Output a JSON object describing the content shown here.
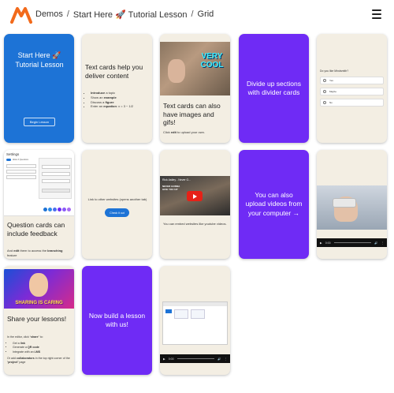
{
  "app": {
    "brand_color": "#f26a1b"
  },
  "breadcrumb": {
    "items": [
      "Demos",
      "Start Here 🚀 Tutorial Lesson",
      "Grid"
    ],
    "separator": "/"
  },
  "menu": {
    "icon": "hamburger-icon"
  },
  "colors": {
    "blue": "#1d73d6",
    "purple": "#6f2bf5",
    "beige": "#f3eee3"
  },
  "cards": {
    "c1": {
      "title": "Start Here 🚀 Tutorial Lesson",
      "button": "Begin Lesson"
    },
    "c2": {
      "title": "Text cards help you deliver content",
      "bullets": [
        {
          "pre": "",
          "bold": "Introduce",
          "post": " a topic"
        },
        {
          "pre": "Show an ",
          "bold": "example",
          "post": ""
        },
        {
          "pre": "Discuss a ",
          "bold": "figure",
          "post": ""
        },
        {
          "pre": "Enter an ",
          "bold": "equation",
          "post": ": x = 3 − 1/2"
        }
      ]
    },
    "c3": {
      "image_text": "VERY COOL",
      "title": "Text cards can also have images and gifs!",
      "caption_pre": "Click ",
      "caption_bold": "edit",
      "caption_post": " to upload your own."
    },
    "c4": {
      "title": "Divide up sections with divider cards"
    },
    "c5": {
      "question": "Do you like Mindsmith?",
      "options": [
        "Yes",
        "Maybe",
        "No"
      ]
    },
    "c6": {
      "settings_title": "Settings",
      "settings_toggle": "Allow 3 Questions",
      "title": "Question cards can include feedback",
      "caption_pre": "And ",
      "caption_bold1": "edit",
      "caption_mid": " them to access the ",
      "caption_bold2": "branching",
      "caption_post": " feature"
    },
    "c7": {
      "text": "Link to other websites (opens another tab)",
      "button": "Check it out"
    },
    "c8": {
      "video_title": "Rick Astley - Never G...",
      "video_sub": "NEVER GONNA GIVE YOU UP",
      "caption": "You can embed websites like youtube videos."
    },
    "c9": {
      "title": "You can also upload videos from your computer →"
    },
    "c10": {
      "time": "0:00"
    },
    "c11": {
      "image_text": "SHARING IS CARING",
      "title": "Share your lessons!",
      "intro_pre": "In the editor, click “",
      "intro_bold": "share",
      "intro_post": "” to:",
      "bullets": [
        {
          "pre": "Get a ",
          "bold": "link",
          "post": ""
        },
        {
          "pre": "Generate a ",
          "bold": "QR code",
          "post": ""
        },
        {
          "pre": "Integrate with an ",
          "bold": "LMS",
          "post": ""
        }
      ],
      "outro_pre": "Or add ",
      "outro_bold1": "collaborators",
      "outro_mid": " in the top right corner of the “",
      "outro_bold2": "project",
      "outro_post": "” page"
    },
    "c12": {
      "title": "Now build a lesson with us!"
    },
    "c13": {
      "time": "0:00"
    }
  }
}
